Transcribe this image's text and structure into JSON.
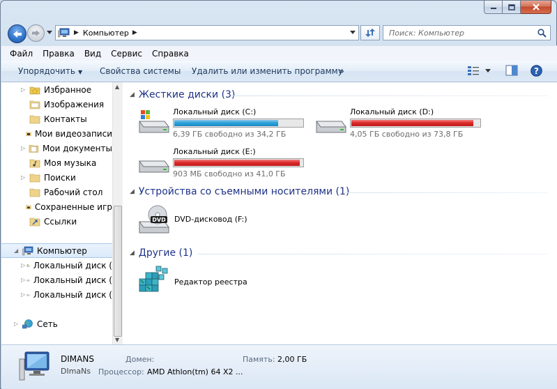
{
  "window": {
    "caption_buttons": [
      "minimize-icon",
      "maximize-icon",
      "close-icon"
    ]
  },
  "navigation": {
    "breadcrumb": "Компьютер",
    "search_placeholder": "Поиск: Компьютер"
  },
  "menu": {
    "items": [
      "Файл",
      "Правка",
      "Вид",
      "Сервис",
      "Справка"
    ]
  },
  "toolbar": {
    "organize": "Упорядочить",
    "system_properties": "Свойства системы",
    "uninstall": "Удалить или изменить программу",
    "more": "»"
  },
  "sidebar": {
    "favorites": [
      {
        "label": "Избранное",
        "icon": "star-folder-icon"
      },
      {
        "label": "Изображения",
        "icon": "folder-icon"
      },
      {
        "label": "Контакты",
        "icon": "folder-icon"
      },
      {
        "label": "Мои видеозаписи",
        "icon": "folder-icon"
      },
      {
        "label": "Мои документы",
        "icon": "folder-icon"
      },
      {
        "label": "Моя музыка",
        "icon": "folder-icon"
      },
      {
        "label": "Поиски",
        "icon": "folder-icon"
      },
      {
        "label": "Рабочий стол",
        "icon": "folder-icon"
      },
      {
        "label": "Сохраненные игр",
        "icon": "folder-icon"
      },
      {
        "label": "Ссылки",
        "icon": "folder-icon"
      }
    ],
    "computer": "Компьютер",
    "drives": [
      "Локальный диск (",
      "Локальный диск (",
      "Локальный диск ("
    ],
    "network": "Сеть"
  },
  "main": {
    "hard_drives_header": "Жесткие диски (3)",
    "drives": [
      {
        "name": "Локальный диск (C:)",
        "free": "6,39 ГБ свободно из 34,2 ГБ",
        "used_fraction": 0.81,
        "color": "#26a0da"
      },
      {
        "name": "Локальный диск (D:)",
        "free": "4,05 ГБ свободно из 73,8 ГБ",
        "used_fraction": 0.95,
        "color": "#da2626"
      },
      {
        "name": "Локальный диск (E:)",
        "free": "903 МБ свободно из 41,0 ГБ",
        "used_fraction": 0.98,
        "color": "#da2626"
      }
    ],
    "removable_header": "Устройства со съемными носителями (1)",
    "dvd": "DVD-дисковод (F:)",
    "other_header": "Другие (1)",
    "regedit": "Редактор реестра"
  },
  "details": {
    "computer_name": "DIMANS",
    "workgroup": "DImaNs",
    "domain_label": "Домен:",
    "processor_label": "Процессор:",
    "processor_value": "AMD Athlon(tm) 64 X2 ...",
    "memory_label": "Память:",
    "memory_value": "2,00 ГБ"
  }
}
